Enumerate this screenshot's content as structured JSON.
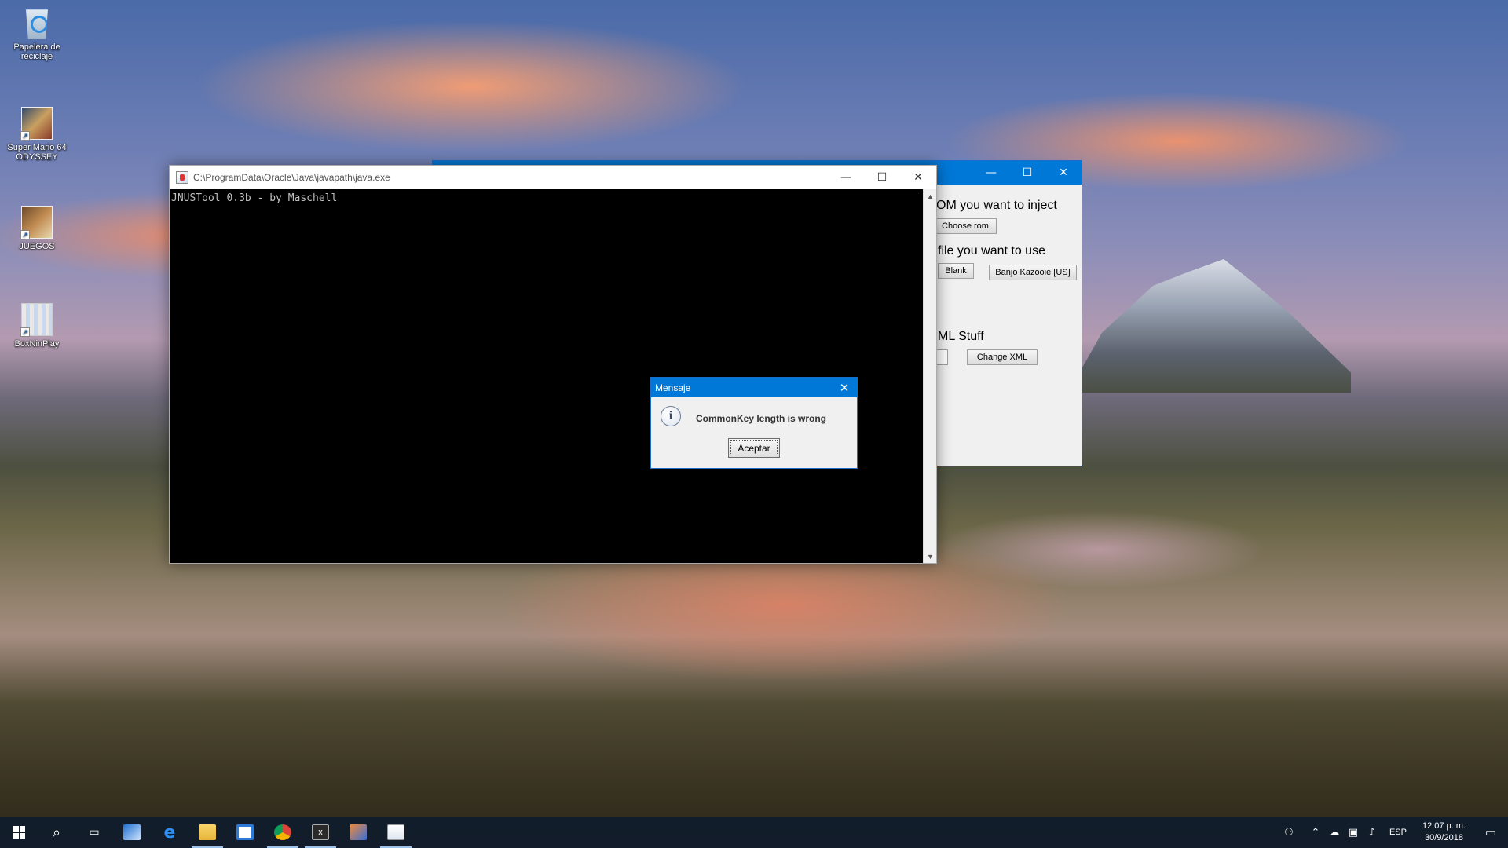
{
  "desktop": {
    "icons": [
      {
        "label": "Papelera de reciclaje",
        "icon": "recycle-bin-icon"
      },
      {
        "label": "Super Mario 64 ODYSSEY",
        "icon": "game-shortcut-icon"
      },
      {
        "label": "JUEGOS",
        "icon": "folder-shortcut-icon"
      },
      {
        "label": "BoxNinPlay",
        "icon": "archive-shortcut-icon"
      }
    ]
  },
  "injector_window": {
    "rom_label": "OM you want to inject",
    "choose_rom_button": "Choose rom",
    "config_label": "file you want to use",
    "blank_button": "Blank",
    "banjo_button": "Banjo Kazooie [US]",
    "xml_label": "ML Stuff",
    "change_xml_button": "Change XML"
  },
  "console_window": {
    "title": "C:\\ProgramData\\Oracle\\Java\\javapath\\java.exe",
    "output": "JNUSTool 0.3b - by Maschell"
  },
  "dialog": {
    "title": "Mensaje",
    "message": "CommonKey length is wrong",
    "ok_button": "Aceptar"
  },
  "taskbar": {
    "language": "ESP",
    "time": "12:07 p. m.",
    "date": "30/9/2018"
  },
  "colors": {
    "accent": "#0078d7",
    "taskbar": "#101c2c"
  }
}
